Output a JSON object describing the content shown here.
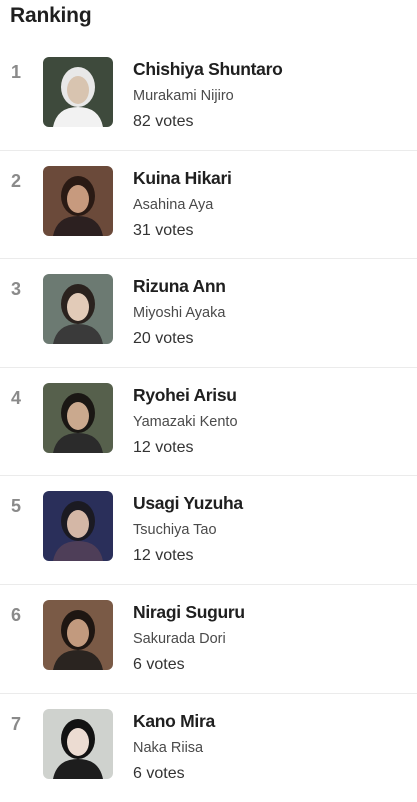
{
  "header": {
    "title": "Ranking"
  },
  "ranking": [
    {
      "rank": "1",
      "name": "Chishiya Shuntaro",
      "actor": "Murakami Nijiro",
      "votes": "82 votes",
      "photo": {
        "bg": "#3e4a3c",
        "skin": "#d8c4b0",
        "hair": "#e8e8e8",
        "top": "#f2f2f2"
      }
    },
    {
      "rank": "2",
      "name": "Kuina Hikari",
      "actor": "Asahina Aya",
      "votes": "31 votes",
      "photo": {
        "bg": "#6b4a3a",
        "skin": "#c79a7e",
        "hair": "#2a1a14",
        "top": "#2c2020"
      }
    },
    {
      "rank": "3",
      "name": "Rizuna Ann",
      "actor": "Miyoshi Ayaka",
      "votes": "20 votes",
      "photo": {
        "bg": "#6c7a72",
        "skin": "#e2cbb8",
        "hair": "#2a221e",
        "top": "#3a3a3a"
      }
    },
    {
      "rank": "4",
      "name": "Ryohei Arisu",
      "actor": "Yamazaki Kento",
      "votes": "12 votes",
      "photo": {
        "bg": "#56604c",
        "skin": "#caa98e",
        "hair": "#1a1714",
        "top": "#2b2b2b"
      }
    },
    {
      "rank": "5",
      "name": "Usagi Yuzuha",
      "actor": "Tsuchiya Tao",
      "votes": "12 votes",
      "photo": {
        "bg": "#2a2f5a",
        "skin": "#d4b7a6",
        "hair": "#1b1a22",
        "top": "#4e3e58"
      }
    },
    {
      "rank": "6",
      "name": "Niragi Suguru",
      "actor": "Sakurada Dori",
      "votes": "6 votes",
      "photo": {
        "bg": "#7a5a46",
        "skin": "#c29a7e",
        "hair": "#1e1612",
        "top": "#2a2420"
      }
    },
    {
      "rank": "7",
      "name": "Kano Mira",
      "actor": "Naka Riisa",
      "votes": "6 votes",
      "photo": {
        "bg": "#cfd2ce",
        "skin": "#ecdcd2",
        "hair": "#121212",
        "top": "#1d1d1d"
      }
    }
  ]
}
